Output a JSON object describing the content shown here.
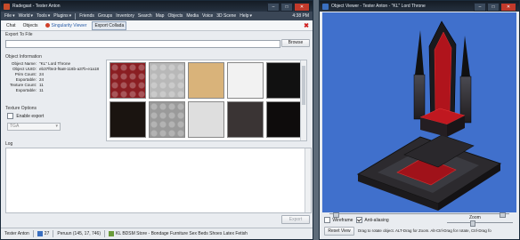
{
  "left_window": {
    "title": "Radegast - Tester Anton",
    "menu": [
      "File",
      "World",
      "Tools",
      "Plugins",
      "Friends",
      "Groups",
      "Inventory",
      "Search",
      "Map",
      "Objects",
      "Media",
      "Voice",
      "3D Scene",
      "Help"
    ],
    "time": "4:38 PM",
    "tabs": [
      "Chat",
      "Objects",
      "Singularity Viewer",
      "Export Collada"
    ],
    "export_label": "Export To File",
    "browse_label": "Browse",
    "object_info": {
      "heading": "Object Information",
      "rows": [
        {
          "k": "Object Name:",
          "v": "\"KL\" Lord Throne"
        },
        {
          "k": "Object UUID:",
          "v": "eb37f0e3-f6a8-116b-a37b-e1a18"
        },
        {
          "k": "Prim Count:",
          "v": "24"
        },
        {
          "k": "Exportable:",
          "v": "24"
        },
        {
          "k": "Texture Count:",
          "v": "11"
        },
        {
          "k": "Exportable:",
          "v": "11"
        }
      ]
    },
    "texture_options": {
      "heading": "Texture Options",
      "enable_export": "Enable export",
      "format": "TGA"
    },
    "log_label": "Log",
    "export_button": "Export",
    "status": {
      "user": "Tester Anton",
      "count": "27",
      "location": "Peruun (145, 17, 746)",
      "parcel": "KL BDSM Store - Bondage Furniture Sex Beds Shoes Latex Fetish"
    }
  },
  "right_window": {
    "title": "Object Viewer - Tester Anton - \"KL\" Lord Throne",
    "wireframe": "Wireframe",
    "anti_aliasing": "Anti-aliasing",
    "zoom_label": "Zoom",
    "reset_view": "Reset View",
    "hint": "Drag to rotate object. ALT-Drag for Zoom. Alt-Ctrl-Drag for rotate, Ctrl-Drag fo"
  },
  "colors": {
    "viewport_bg": "#4070cc",
    "titlebar": "#1c2530",
    "menubar": "#3a4656"
  },
  "thumbnails": [
    {
      "name": "red-tufted-leather-texture",
      "color": "#8a1e22"
    },
    {
      "name": "silver-tufted-texture",
      "color": "#b8b8b8"
    },
    {
      "name": "tan-wood-texture",
      "color": "#d9b37a"
    },
    {
      "name": "white-texture",
      "color": "#f2f2f2"
    },
    {
      "name": "black-texture",
      "color": "#111111"
    },
    {
      "name": "black-trim-texture",
      "color": "#1a1410"
    },
    {
      "name": "grey-tile-texture",
      "color": "#9a9a9a"
    },
    {
      "name": "white-marble-texture",
      "color": "#dedede"
    },
    {
      "name": "dark-granite-texture",
      "color": "#3a3434"
    },
    {
      "name": "black-rivet-texture",
      "color": "#0e0c0c"
    }
  ]
}
